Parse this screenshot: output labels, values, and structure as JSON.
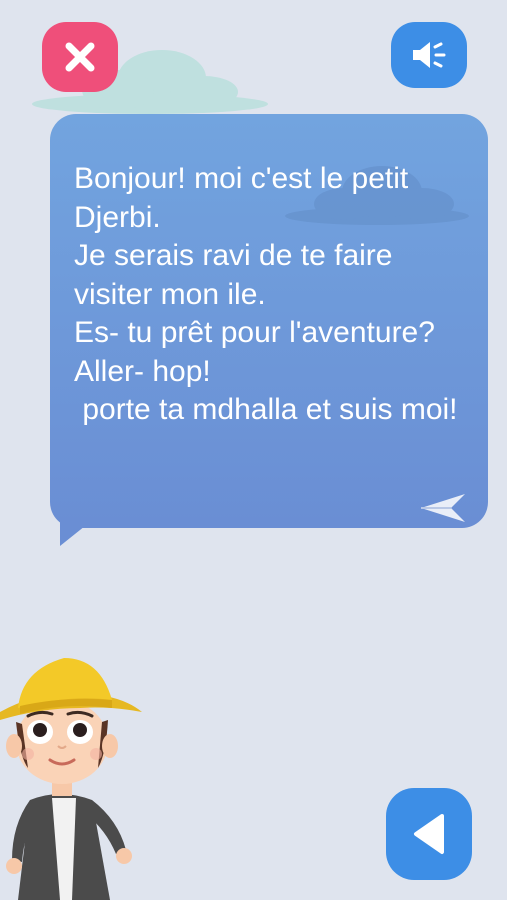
{
  "dialog": {
    "message": "Bonjour! moi c'est le petit Djerbi.\nJe serais ravi de te faire visiter mon ile.\nEs- tu prêt pour l'aventure?\nAller- hop!\n porte ta mdhalla et suis moi!"
  },
  "icons": {
    "close": "close-x-icon",
    "sound": "speaker-icon",
    "next": "paper-plane-arrow-icon",
    "back": "triangle-left-icon"
  },
  "colors": {
    "background": "#dfe4ee",
    "close_button": "#ef4f7a",
    "primary_button": "#3d8ee6",
    "bubble_top": "#72a4df",
    "bubble_bottom": "#6a8ed4",
    "hat": "#f3c928"
  }
}
